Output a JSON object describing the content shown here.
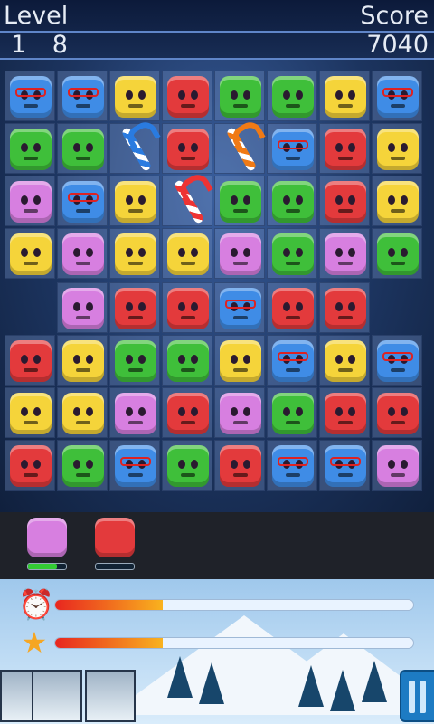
{
  "hud": {
    "level_label": "Level",
    "level_value": "1 8",
    "score_label": "Score",
    "score_value": "7040"
  },
  "colors": {
    "red": "#e33a3c",
    "green": "#3fbf3a",
    "blue": "#3f8ce6",
    "yellow": "#f5d43a",
    "pink": "#d77fe0"
  },
  "board": {
    "rows": [
      [
        "blue-glasses",
        "blue-glasses",
        "yellow",
        "red",
        "green-mustache",
        "green-mustache",
        "yellow",
        "blue-glasses"
      ],
      [
        "green-mustache",
        "green-mustache",
        "candy-blue",
        "red",
        "candy-orange",
        "blue-glasses",
        "red",
        "yellow"
      ],
      [
        "pink",
        "blue-glasses",
        "yellow",
        "candy-red",
        "green-mustache",
        "green-mustache",
        "red",
        "yellow"
      ],
      [
        "yellow",
        "pink",
        "yellow",
        "yellow",
        "pink",
        "green-mustache",
        "pink",
        "green-mustache"
      ],
      [
        "empty",
        "pink",
        "red",
        "red",
        "blue-glasses",
        "red",
        "red",
        "empty"
      ],
      [
        "red",
        "yellow",
        "green-mustache",
        "green-mustache",
        "yellow",
        "blue-glasses",
        "yellow",
        "blue-glasses"
      ],
      [
        "yellow",
        "yellow",
        "pink",
        "red",
        "pink",
        "green-mustache",
        "red",
        "red"
      ],
      [
        "red",
        "green-mustache",
        "blue-glasses",
        "green-mustache",
        "red",
        "blue-glasses",
        "blue-glasses",
        "pink"
      ]
    ]
  },
  "tray": [
    {
      "piece": "pink",
      "meter_fraction": 0.75,
      "meter_color": "#3c3"
    },
    {
      "piece": "red",
      "meter_fraction": 0.0,
      "meter_color": "#3c3"
    }
  ],
  "timer_bar": {
    "icon": "alarm-clock-icon",
    "fraction": 0.3
  },
  "star_bar": {
    "icon": "star-icon",
    "fraction": 0.3
  },
  "thumbnails": [
    "winter-scene-1",
    "winter-scene-2",
    "winter-scene-3"
  ]
}
